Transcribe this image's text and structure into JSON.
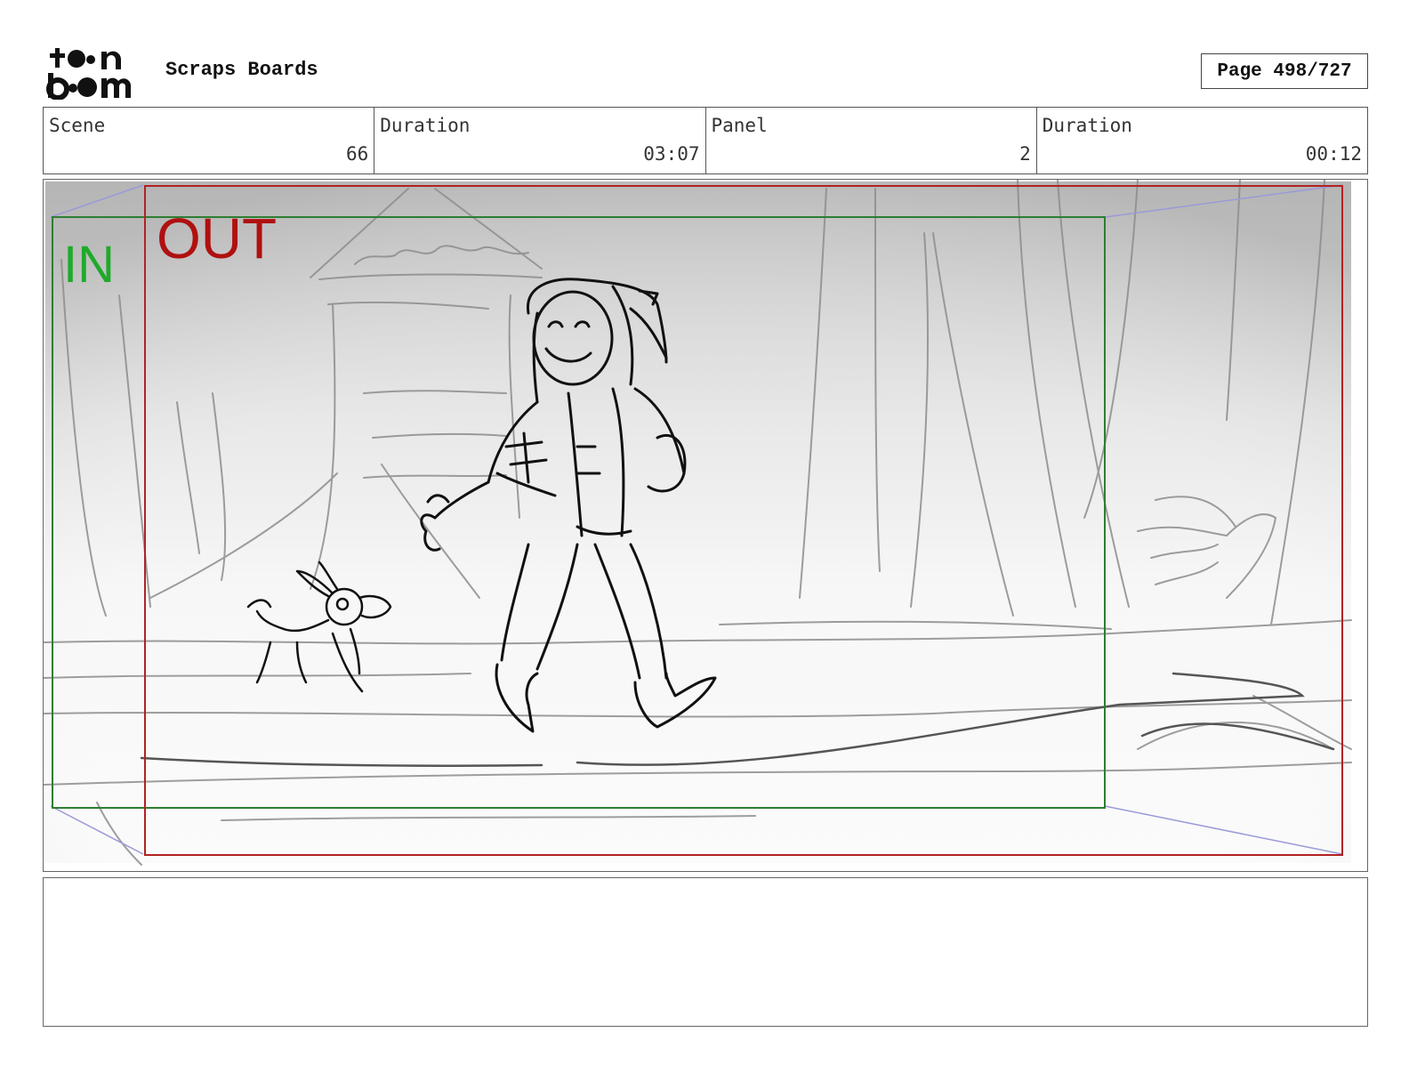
{
  "header": {
    "logo_text": "toon boom",
    "title": "Scraps Boards",
    "page": "Page 498/727"
  },
  "info": {
    "scene_label": "Scene",
    "scene_value": "66",
    "scene_duration_label": "Duration",
    "scene_duration_value": "03:07",
    "panel_label": "Panel",
    "panel_value": "2",
    "panel_duration_label": "Duration",
    "panel_duration_value": "00:12"
  },
  "panel": {
    "in_label": "IN",
    "out_label": "OUT",
    "colors": {
      "in_frame": "#2e7d32",
      "in_text": "#1faa2a",
      "out_frame": "#b22222",
      "out_text": "#b01010",
      "camera_path": "#9a9ad8"
    }
  },
  "notes": {
    "text": ""
  }
}
